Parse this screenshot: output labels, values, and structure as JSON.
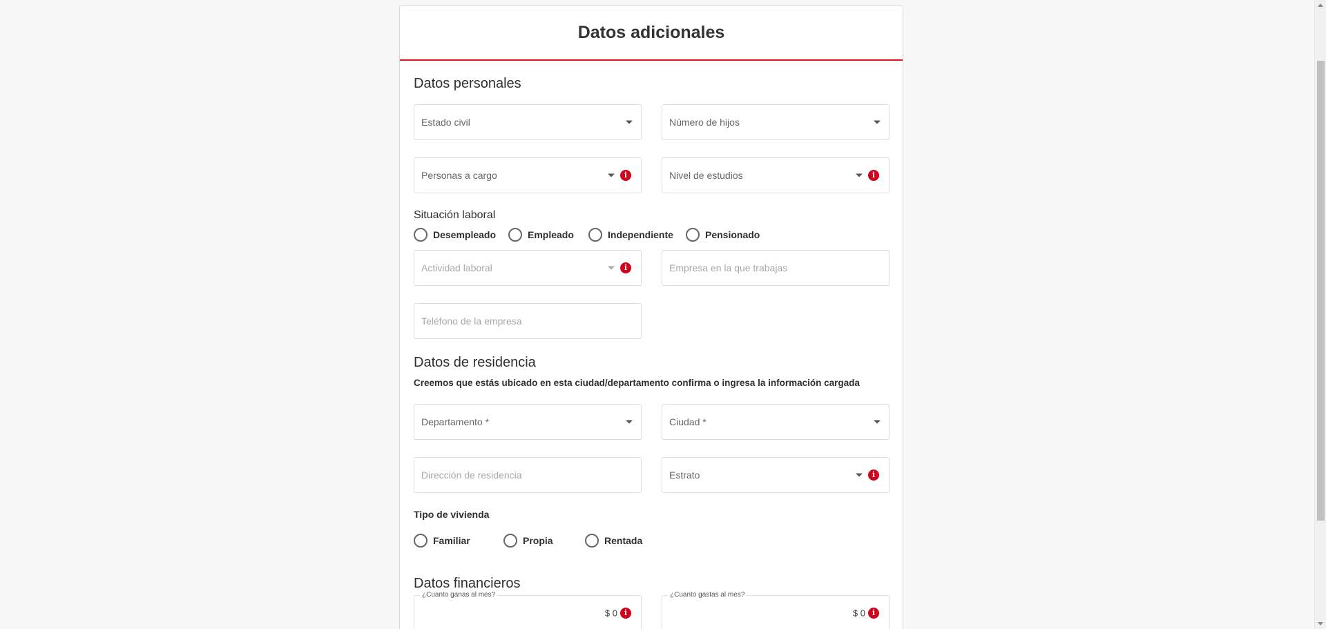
{
  "page": {
    "title": "Datos adicionales"
  },
  "personal": {
    "title": "Datos personales",
    "estado_civil": "Estado civil",
    "numero_hijos": "Número de hijos",
    "personas_cargo": "Personas a cargo",
    "nivel_estudios": "Nivel de estudios"
  },
  "laboral": {
    "title": "Situación laboral",
    "options": [
      "Desempleado",
      "Empleado",
      "Independiente",
      "Pensionado"
    ],
    "actividad": "Actividad laboral",
    "empresa": "Empresa en la que trabajas",
    "telefono": "Teléfono de la empresa"
  },
  "residencia": {
    "title": "Datos de residencia",
    "note": "Creemos que estás ubicado en esta ciudad/departamento confirma o ingresa la información cargada",
    "departamento": "Departamento *",
    "ciudad": "Ciudad *",
    "direccion": "Dirección de residencia",
    "estrato": "Estrato",
    "vivienda_label": "Tipo de vivienda",
    "vivienda_options": [
      "Familiar",
      "Propia",
      "Rentada"
    ]
  },
  "financieros": {
    "title": "Datos financieros",
    "ingresos_label": "¿Cuanto ganas al mes?",
    "ingresos_value": "$ 0",
    "gastos_label": "¿Cuanto gastas al mes?",
    "gastos_value": "$ 0"
  },
  "icons": {
    "info": "i"
  },
  "colors": {
    "accent": "#e0141e",
    "info": "#d0021b"
  }
}
